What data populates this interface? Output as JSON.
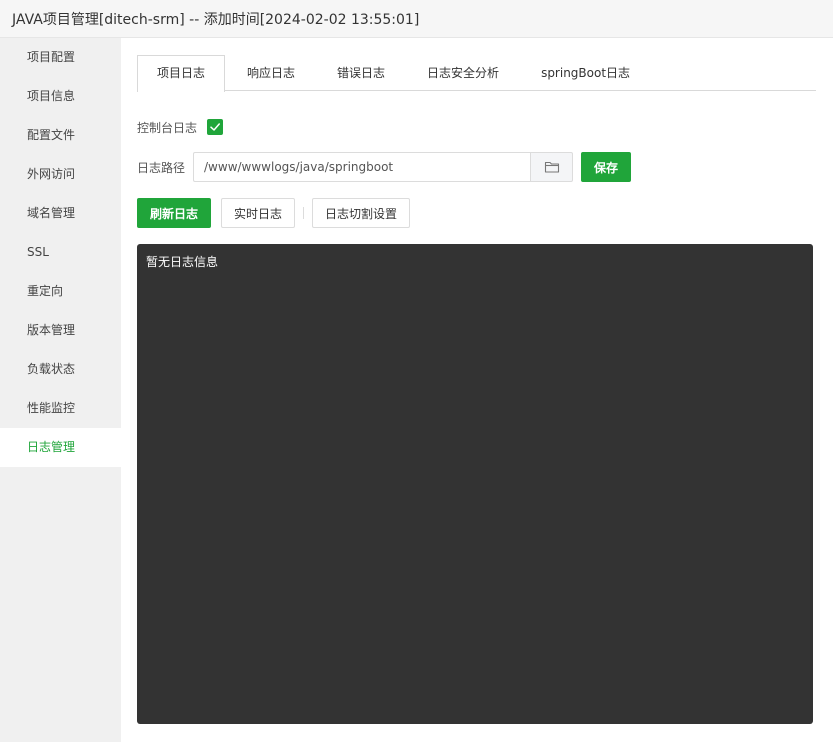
{
  "window": {
    "title": "JAVA项目管理[ditech-srm] -- 添加时间[2024-02-02 13:55:01]"
  },
  "sidebar": {
    "items": [
      {
        "label": "项目配置"
      },
      {
        "label": "项目信息"
      },
      {
        "label": "配置文件"
      },
      {
        "label": "外网访问"
      },
      {
        "label": "域名管理"
      },
      {
        "label": "SSL"
      },
      {
        "label": "重定向"
      },
      {
        "label": "版本管理"
      },
      {
        "label": "负载状态"
      },
      {
        "label": "性能监控"
      },
      {
        "label": "日志管理"
      }
    ],
    "active_index": 10
  },
  "tabs": [
    {
      "label": "项目日志"
    },
    {
      "label": "响应日志"
    },
    {
      "label": "错误日志"
    },
    {
      "label": "日志安全分析"
    },
    {
      "label": "springBoot日志"
    }
  ],
  "active_tab": 0,
  "console_log": {
    "label": "控制台日志",
    "checked": true
  },
  "log_path": {
    "label": "日志路径",
    "value": "/www/wwwlogs/java/springboot"
  },
  "buttons": {
    "save": "保存",
    "refresh": "刷新日志",
    "realtime": "实时日志",
    "split": "日志切割设置"
  },
  "log_output": {
    "text": "暂无日志信息"
  },
  "colors": {
    "accent": "#20a53a",
    "log_bg": "#333333",
    "sidebar_bg": "#f0f0f0"
  },
  "icons": {
    "folder": "folder-icon",
    "check": "check-icon"
  }
}
